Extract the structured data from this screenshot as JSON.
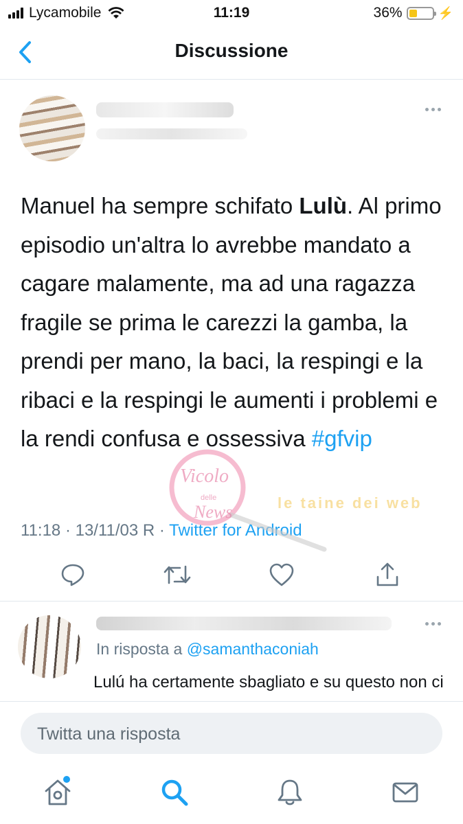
{
  "status_bar": {
    "carrier": "Lycamobile",
    "time": "11:19",
    "battery_percent": "36%",
    "battery_level": 0.36
  },
  "header": {
    "title": "Discussione"
  },
  "tweet": {
    "text_before": "Manuel ha sempre schifato ",
    "text_bold": "Lulù",
    "text_after": ". Al primo episodio un'altra lo avrebbe mandato a cagare malamente, ma ad una ragazza fragile se prima le carezzi la gamba, la prendi per mano, la baci, la respingi e la ribaci e la respingi le aumenti i problemi e la rendi confusa e ossessiva ",
    "hashtag": "#gfvip",
    "timestamp": "11:18 · 13/11/03 R · ",
    "source": "Twitter for Android"
  },
  "watermark": {
    "line1": "Vicolo",
    "line2": "delle",
    "line3": "News",
    "banner": "le taine dei web"
  },
  "reply": {
    "in_reply_prefix": "In risposta a ",
    "mention": "@samanthaconiah",
    "text": "Lulú ha certamente sbagliato e su questo non ci piove, ma per me Manuel l'ha"
  },
  "composer": {
    "placeholder": "Twitta una risposta"
  },
  "icons": {
    "back": "chevron-left-icon",
    "more": "more-dots-icon",
    "reply": "reply-icon",
    "retweet": "retweet-icon",
    "like": "heart-icon",
    "share": "share-icon",
    "home": "home-icon",
    "search": "search-icon",
    "notifications": "bell-icon",
    "messages": "mail-icon"
  },
  "colors": {
    "accent": "#1da1f2",
    "text": "#14171a",
    "secondary": "#657786",
    "battery": "#f5c518"
  }
}
